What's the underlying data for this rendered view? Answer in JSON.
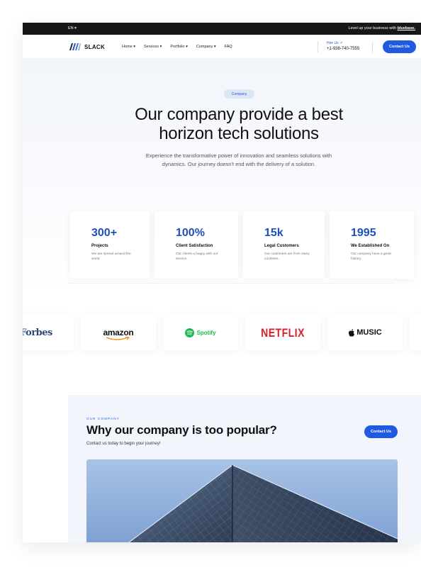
{
  "topbar": {
    "language": "EN ▾",
    "promo_prefix": "Level up your business with ",
    "promo_brand": "bluebase."
  },
  "navbar": {
    "logo_text": "SLACK",
    "links": [
      "Home ▾",
      "Services ▾",
      "Portfolio ▾",
      "Company ▾",
      "FAQ"
    ],
    "hire_label": "Hire Us ↗",
    "phone": "+1-938-740-7555",
    "cta_label": "Contact Us"
  },
  "hero": {
    "badge": "Company",
    "title_line1": "Our company provide a best",
    "title_line2": "horizon tech solutions",
    "subtitle_line1": "Experience the transformative power of innovation and seamless solutions with",
    "subtitle_line2": "dynamics. Our journey doesn't end with the delivery of a solution."
  },
  "stats": [
    {
      "value": "300+",
      "title": "Projects",
      "desc": "We are spread around the world."
    },
    {
      "value": "100%",
      "title": "Client Satisfaction",
      "desc": "Our clients a happy with our service."
    },
    {
      "value": "15k",
      "title": "Legal Customers",
      "desc": "Our customers are from many countries."
    },
    {
      "value": "1995",
      "title": "We Established On",
      "desc": "Our company have a great history."
    }
  ],
  "brands": {
    "forbes": "Forbes",
    "amazon": "amazon",
    "spotify": "Spotify",
    "netflix": "NETFLIX",
    "music": "MUSIC"
  },
  "section2": {
    "eyebrow": "OUR COMPANY",
    "title": "Why our company is too popular?",
    "subtitle": "Contact us today to begin your journey!",
    "cta_label": "Contact Us"
  },
  "colors": {
    "accent": "#1f5ae0",
    "stat_value": "#1f4fb8",
    "topbar_bg": "#171717",
    "netflix": "#d81f26",
    "spotify": "#1db954"
  }
}
